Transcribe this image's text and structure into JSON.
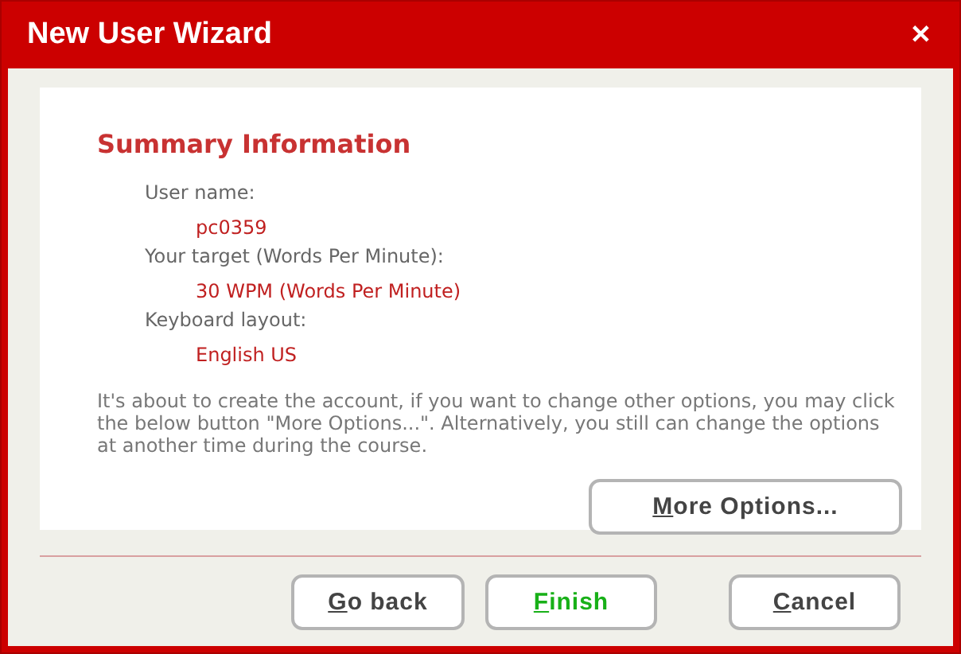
{
  "window": {
    "title": "New User Wizard",
    "close": "✕"
  },
  "heading": "Summary Information",
  "fields": [
    {
      "label": "User name:",
      "value": "pc0359"
    },
    {
      "label": "Your target (Words Per Minute):",
      "value": "30 WPM (Words Per Minute)"
    },
    {
      "label": "Keyboard layout:",
      "value": "English US"
    }
  ],
  "note": "It's about to create the account, if you want to change other options, you may click the below button \"More Options...\". Alternatively, you still can change the options at another time during the course.",
  "more_button": {
    "mnemonic": "M",
    "rest": "ore Options..."
  },
  "buttons": [
    {
      "kind": "normal",
      "mnemonic": "G",
      "rest": "o back"
    },
    {
      "kind": "primary",
      "mnemonic": "F",
      "rest": "inish"
    },
    {
      "kind": "normal",
      "mnemonic": "C",
      "rest": "ancel"
    }
  ]
}
